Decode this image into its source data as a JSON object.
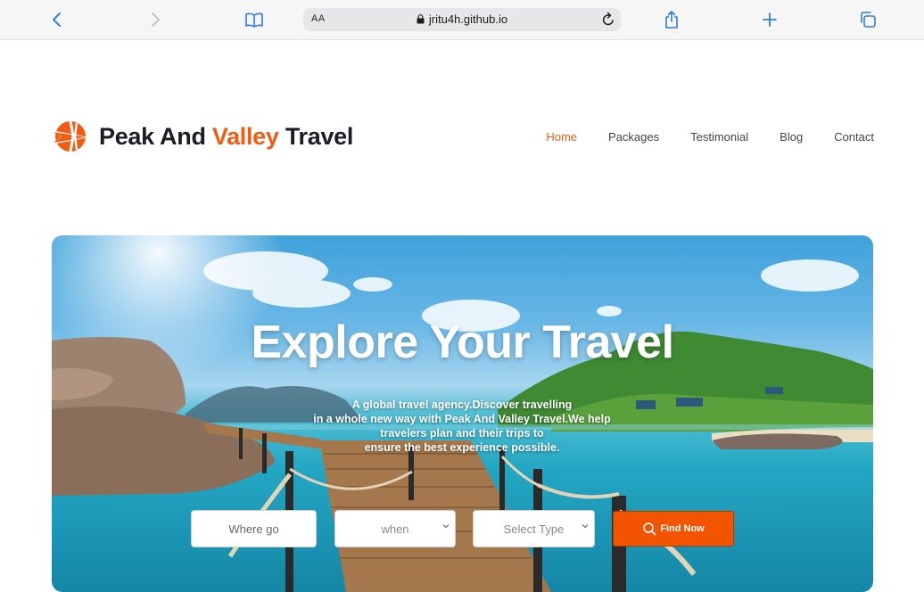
{
  "browser": {
    "reader_label": "AA",
    "url": "jritu4h.github.io",
    "icons": [
      "back-icon",
      "forward-icon",
      "book-icon",
      "lock-icon",
      "reload-icon",
      "share-icon",
      "plus-icon",
      "tabs-icon"
    ]
  },
  "site": {
    "brand": {
      "part1": "Peak And ",
      "accent": "Valley",
      "part3": " Travel"
    },
    "accent_color": "#f35a12",
    "nav": [
      {
        "label": "Home",
        "active": true
      },
      {
        "label": "Packages",
        "active": false
      },
      {
        "label": "Testimonial",
        "active": false
      },
      {
        "label": "Blog",
        "active": false
      },
      {
        "label": "Contact",
        "active": false
      }
    ]
  },
  "hero": {
    "title": "Explore Your Travel",
    "subtitle_lines": [
      "A global travel agency.Discover travelling",
      "in a whole new way with Peak And Valley Travel.We help",
      "travelers plan and their trips to",
      "ensure the best experience possible."
    ],
    "search": {
      "where_placeholder": "Where go",
      "when_value": "when",
      "type_value": "Select Type",
      "button_label": "Find Now",
      "button_color": "#f25400"
    }
  }
}
